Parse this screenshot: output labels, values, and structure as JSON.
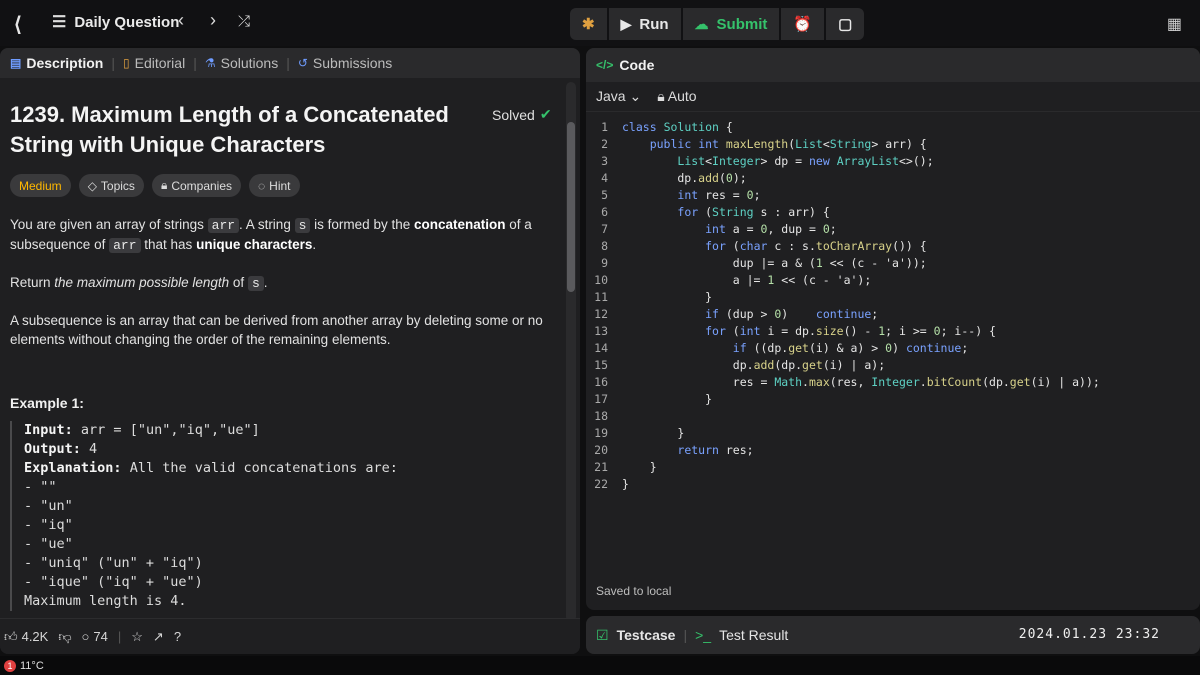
{
  "topbar": {
    "title": "Daily Question",
    "prev_icon": "chevron-left-icon",
    "next_icon": "chevron-right-icon",
    "shuffle_icon": "shuffle-icon",
    "run_label": "Run",
    "submit_label": "Submit"
  },
  "left": {
    "tabs": [
      "Description",
      "Editorial",
      "Solutions",
      "Submissions"
    ],
    "title_line1": "1239. Maximum Length of a Concatenated",
    "title_line2": "String with Unique Characters",
    "solved": "Solved",
    "chips": [
      "Medium",
      "Topics",
      "Companies",
      "Hint"
    ],
    "p1_a": "You are given an array of strings",
    "p1_code1": "arr",
    "p1_b": ". A string",
    "p1_code2": "s",
    "p1_c": "is formed by the",
    "p1_bold1": "concatenation",
    "p1_d": "of a subsequence of",
    "p1_code3": "arr",
    "p1_e": "that has",
    "p1_bold2": "unique characters",
    "p1_f": ".",
    "p2_a": "Return",
    "p2_i": "the maximum possible length",
    "p2_b": "of",
    "p2_code": "s",
    "p2_c": ".",
    "p3": "A subsequence is an array that can be derived from another array by deleting some or no elements without changing the order of the remaining elements.",
    "example_heading": "Example 1:",
    "ex_input_k": "Input:",
    "ex_input_v": "arr = [\"un\",\"iq\",\"ue\"]",
    "ex_output_k": "Output:",
    "ex_output_v": "4",
    "ex_expl_k": "Explanation:",
    "ex_expl_v": "All the valid concatenations are:",
    "ex_lines": [
      "- \"\"",
      "- \"un\"",
      "- \"iq\"",
      "- \"ue\"",
      "- \"uniq\" (\"un\" + \"iq\")",
      "- \"ique\" (\"iq\" + \"ue\")",
      "Maximum length is 4."
    ],
    "likes": "4.2K",
    "comments": "74"
  },
  "right": {
    "header": "Code",
    "language": "Java",
    "auto": "Auto",
    "saved": "Saved to local",
    "testcase": "Testcase",
    "test_result": "Test Result"
  },
  "code_lines": [
    "class Solution {",
    "    public int maxLength(List<String> arr) {",
    "        List<Integer> dp = new ArrayList<>();",
    "        dp.add(0);",
    "        int res = 0;",
    "        for (String s : arr) {",
    "            int a = 0, dup = 0;",
    "            for (char c : s.toCharArray()) {",
    "                dup |= a & (1 << (c - 'a'));",
    "                a |= 1 << (c - 'a');",
    "            }",
    "            if (dup > 0)    continue;",
    "            for (int i = dp.size() - 1; i >= 0; i--) {",
    "                if ((dp.get(i) & a) > 0) continue;",
    "                dp.add(dp.get(i) | a);",
    "                res = Math.max(res, Integer.bitCount(dp.get(i) | a));",
    "            }",
    "",
    "        }",
    "        return res;",
    "    }",
    "}"
  ],
  "timestamp": "2024.01.23 23:32",
  "taskbar": {
    "badge": "1",
    "temp": "11°C"
  }
}
